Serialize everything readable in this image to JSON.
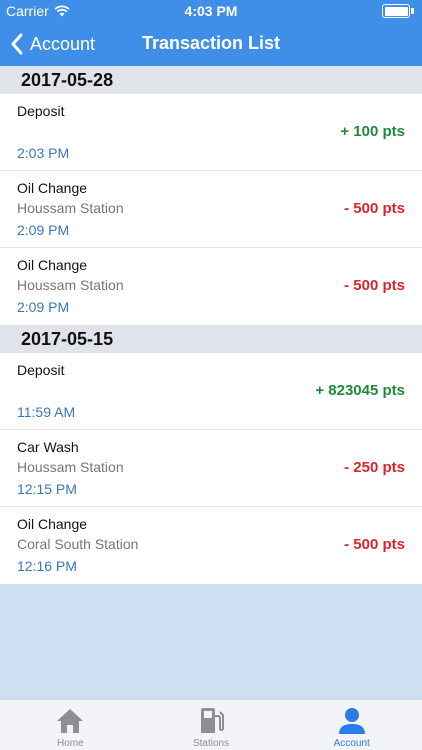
{
  "status": {
    "carrier": "Carrier",
    "time": "4:03 PM"
  },
  "nav": {
    "back_label": "Account",
    "title": "Transaction List"
  },
  "sections": [
    {
      "date": "2017-05-28",
      "transactions": [
        {
          "title": "Deposit",
          "subtitle": "",
          "time": "2:03 PM",
          "amount": "+ 100 pts",
          "kind": "credit"
        },
        {
          "title": "Oil Change",
          "subtitle": "Houssam Station",
          "time": "2:09 PM",
          "amount": "- 500 pts",
          "kind": "debit"
        },
        {
          "title": "Oil Change",
          "subtitle": "Houssam Station",
          "time": "2:09 PM",
          "amount": "- 500 pts",
          "kind": "debit"
        }
      ]
    },
    {
      "date": "2017-05-15",
      "transactions": [
        {
          "title": "Deposit",
          "subtitle": "",
          "time": "11:59 AM",
          "amount": "+ 823045 pts",
          "kind": "credit"
        },
        {
          "title": "Car Wash",
          "subtitle": "Houssam Station",
          "time": "12:15 PM",
          "amount": "- 250 pts",
          "kind": "debit"
        },
        {
          "title": "Oil Change",
          "subtitle": "Coral South Station",
          "time": "12:16 PM",
          "amount": "- 500 pts",
          "kind": "debit"
        }
      ]
    }
  ],
  "tabs": [
    {
      "label": "Home",
      "icon": "home-icon",
      "active": false
    },
    {
      "label": "Stations",
      "icon": "fuel-pump-icon",
      "active": false
    },
    {
      "label": "Account",
      "icon": "person-icon",
      "active": true
    }
  ],
  "colors": {
    "header": "#3f8fe8",
    "credit": "#1e8b3a",
    "debit": "#d8262b",
    "time": "#3a78b8",
    "tab_active": "#2b7de9",
    "tab_inactive": "#8e8e93"
  }
}
